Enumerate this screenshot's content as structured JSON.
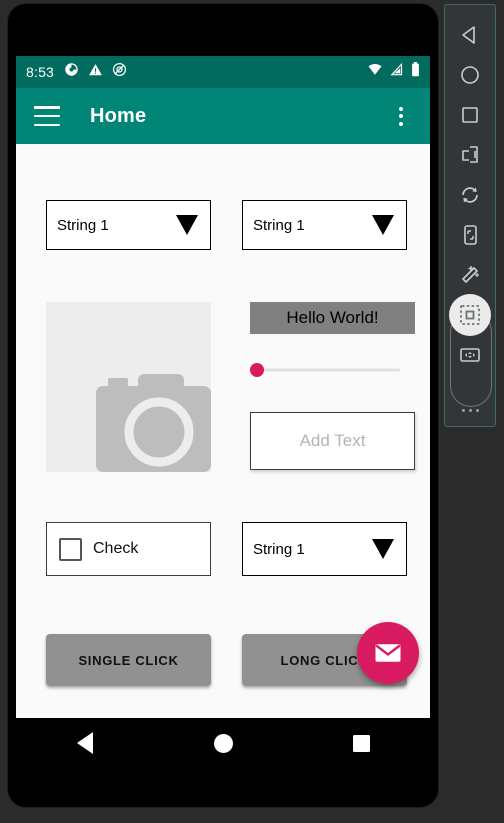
{
  "status_bar": {
    "time": "8:53",
    "left_icons": [
      "sync-icon",
      "warning-icon",
      "do-not-disturb-icon"
    ],
    "right_icons": [
      "wifi-icon",
      "cellular-signal-icon",
      "battery-icon"
    ],
    "background_color": "#006b5e"
  },
  "app_bar": {
    "menu_icon": "hamburger-menu-icon",
    "title": "Home",
    "overflow_icon": "overflow-menu-icon",
    "background_color": "#008577",
    "text_color": "#ffffff"
  },
  "content": {
    "spinner_top_left": {
      "value": "String 1",
      "arrow_icon": "dropdown-arrow-icon"
    },
    "spinner_top_right": {
      "value": "String 1",
      "arrow_icon": "dropdown-arrow-icon"
    },
    "image_view": {
      "placeholder_icon": "camera-icon",
      "background_color": "#ededed"
    },
    "hello_text": {
      "text": "Hello World!",
      "background_color": "#808080",
      "text_color": "#000000"
    },
    "seekbar": {
      "value": 0,
      "min": 0,
      "max": 100,
      "thumb_color": "#d81b60",
      "track_color": "#e0e0e0"
    },
    "edit_text": {
      "value": "",
      "placeholder": "Add Text"
    },
    "checkbox": {
      "label": "Check",
      "checked": false
    },
    "spinner_bottom_right": {
      "value": "String 1",
      "arrow_icon": "dropdown-arrow-icon"
    },
    "button_single_click": {
      "label": "SINGLE CLICK"
    },
    "button_long_click": {
      "label": "LONG CLICK"
    },
    "fab": {
      "icon": "envelope-icon",
      "color": "#d81b60"
    }
  },
  "nav_bar": {
    "back": "back-triangle-icon",
    "home": "home-circle-icon",
    "recents": "recents-square-icon"
  },
  "emulator_toolbar": {
    "buttons": [
      {
        "name": "back-button",
        "icon": "back-triangle-icon",
        "selected": false
      },
      {
        "name": "home-button",
        "icon": "home-circle-icon",
        "selected": false
      },
      {
        "name": "overview-button",
        "icon": "overview-square-icon",
        "selected": false
      },
      {
        "name": "fold-button",
        "icon": "fold-device-icon",
        "selected": false
      },
      {
        "name": "rotate-button",
        "icon": "rotate-icon",
        "selected": false
      },
      {
        "name": "screenshot-button",
        "icon": "device-screenshot-icon",
        "selected": false
      },
      {
        "name": "record-button",
        "icon": "magic-wand-pencil-icon",
        "selected": false
      },
      {
        "name": "layout-inspector-button",
        "icon": "dashed-square-icon",
        "selected": true
      },
      {
        "name": "resize-button",
        "icon": "resize-frame-icon",
        "selected": false
      }
    ],
    "more_icon": "more-dots-icon"
  }
}
